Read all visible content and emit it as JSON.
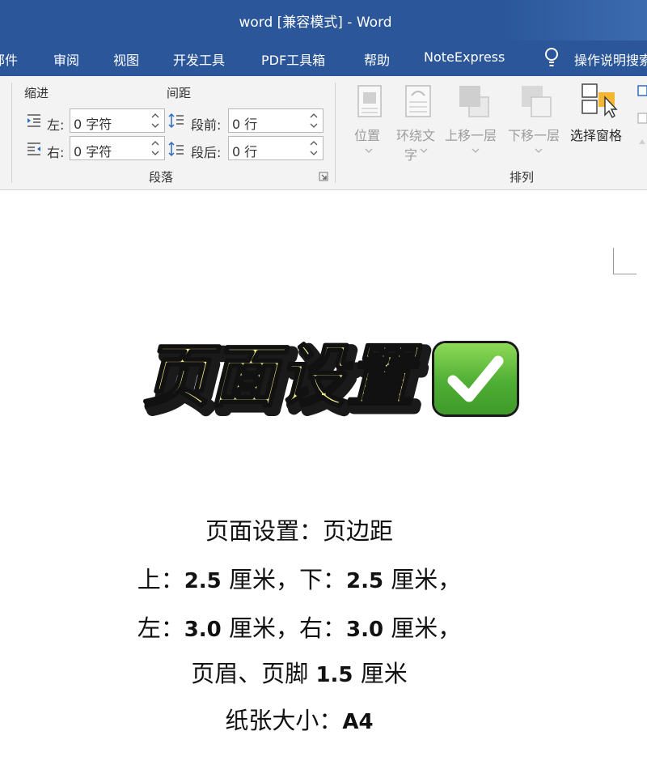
{
  "window": {
    "title": "word [兼容模式]  -  Word"
  },
  "tabs": [
    {
      "label": "邮件"
    },
    {
      "label": "审阅"
    },
    {
      "label": "视图"
    },
    {
      "label": "开发工具"
    },
    {
      "label": "PDF工具箱"
    },
    {
      "label": "帮助"
    },
    {
      "label": "NoteExpress"
    },
    {
      "label": "操作说明搜索"
    }
  ],
  "paragraph_group": {
    "indent_label": "缩进",
    "spacing_label": "间距",
    "left_label": "左:",
    "right_label": "右:",
    "left_value": "0 字符",
    "right_value": "0 字符",
    "before_label": "段前:",
    "after_label": "段后:",
    "before_value": "0 行",
    "after_value": "0 行",
    "group_label": "段落"
  },
  "arrange_group": {
    "position": "位置",
    "wrap_text_1": "环绕文",
    "wrap_text_2": "字",
    "bring_forward": "上移一层",
    "send_backward": "下移一层",
    "selection_pane": "选择窗格",
    "group_label": "排列"
  },
  "document": {
    "headline": "页面设置",
    "lines": [
      {
        "text": "页面设置：页边距"
      },
      {
        "pre": "上：",
        "num1": "2.5",
        "mid": " 厘米，下：",
        "num2": "2.5",
        "post": " 厘米，"
      },
      {
        "pre": "左：",
        "num1": "3.0",
        "mid": " 厘米，右：",
        "num2": "3.0",
        "post": " 厘米，"
      },
      {
        "pre": "页眉、页脚 ",
        "num1": "1.5",
        "post": " 厘米"
      },
      {
        "pre": "纸张大小：",
        "num1": "A4"
      }
    ]
  },
  "colors": {
    "word_blue": "#2b579a",
    "ribbon_bg": "#f3f3f3",
    "check_green": "#4fae34",
    "headline_fill": "#f3f08a"
  }
}
